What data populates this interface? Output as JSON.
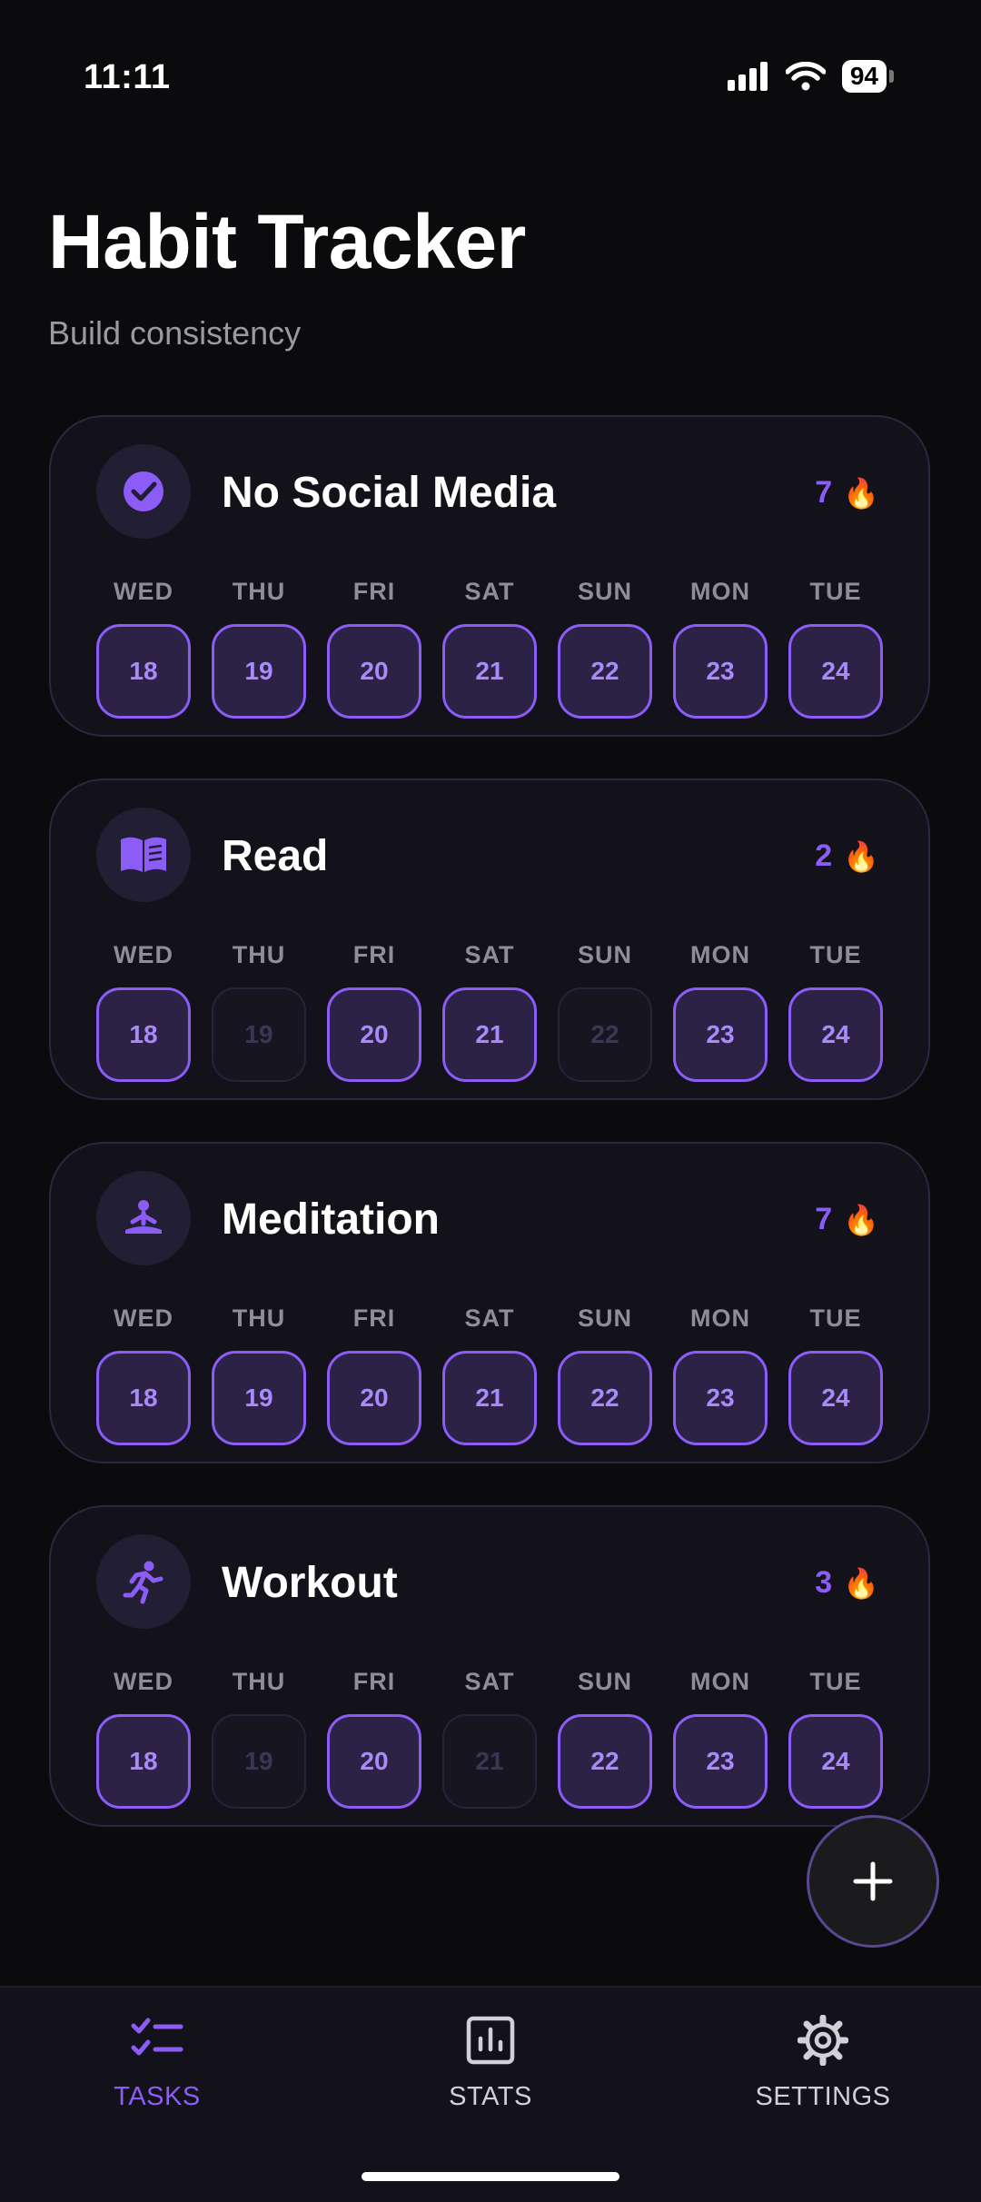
{
  "status_bar": {
    "time": "11:11",
    "battery": "94"
  },
  "header": {
    "title": "Habit Tracker",
    "subtitle": "Build consistency"
  },
  "accent_color": "#8b5cf6",
  "habits": [
    {
      "name": "No Social Media",
      "icon": "check-circle-icon",
      "streak": "7",
      "streak_icon": "🔥",
      "days": [
        {
          "label": "WED",
          "date": "18",
          "done": true
        },
        {
          "label": "THU",
          "date": "19",
          "done": true
        },
        {
          "label": "FRI",
          "date": "20",
          "done": true
        },
        {
          "label": "SAT",
          "date": "21",
          "done": true
        },
        {
          "label": "SUN",
          "date": "22",
          "done": true
        },
        {
          "label": "MON",
          "date": "23",
          "done": true
        },
        {
          "label": "TUE",
          "date": "24",
          "done": true
        }
      ]
    },
    {
      "name": "Read",
      "icon": "book-icon",
      "streak": "2",
      "streak_icon": "🔥",
      "days": [
        {
          "label": "WED",
          "date": "18",
          "done": true
        },
        {
          "label": "THU",
          "date": "19",
          "done": false
        },
        {
          "label": "FRI",
          "date": "20",
          "done": true
        },
        {
          "label": "SAT",
          "date": "21",
          "done": true
        },
        {
          "label": "SUN",
          "date": "22",
          "done": false
        },
        {
          "label": "MON",
          "date": "23",
          "done": true
        },
        {
          "label": "TUE",
          "date": "24",
          "done": true
        }
      ]
    },
    {
      "name": "Meditation",
      "icon": "meditation-icon",
      "streak": "7",
      "streak_icon": "🔥",
      "days": [
        {
          "label": "WED",
          "date": "18",
          "done": true
        },
        {
          "label": "THU",
          "date": "19",
          "done": true
        },
        {
          "label": "FRI",
          "date": "20",
          "done": true
        },
        {
          "label": "SAT",
          "date": "21",
          "done": true
        },
        {
          "label": "SUN",
          "date": "22",
          "done": true
        },
        {
          "label": "MON",
          "date": "23",
          "done": true
        },
        {
          "label": "TUE",
          "date": "24",
          "done": true
        }
      ]
    },
    {
      "name": "Workout",
      "icon": "running-icon",
      "streak": "3",
      "streak_icon": "🔥",
      "days": [
        {
          "label": "WED",
          "date": "18",
          "done": true
        },
        {
          "label": "THU",
          "date": "19",
          "done": false
        },
        {
          "label": "FRI",
          "date": "20",
          "done": true
        },
        {
          "label": "SAT",
          "date": "21",
          "done": false
        },
        {
          "label": "SUN",
          "date": "22",
          "done": true
        },
        {
          "label": "MON",
          "date": "23",
          "done": true
        },
        {
          "label": "TUE",
          "date": "24",
          "done": true
        }
      ]
    }
  ],
  "fab": {
    "icon": "plus-icon"
  },
  "nav": {
    "items": [
      {
        "label": "TASKS",
        "icon": "tasks-icon",
        "active": true
      },
      {
        "label": "STATS",
        "icon": "stats-icon",
        "active": false
      },
      {
        "label": "SETTINGS",
        "icon": "gear-icon",
        "active": false
      }
    ]
  }
}
